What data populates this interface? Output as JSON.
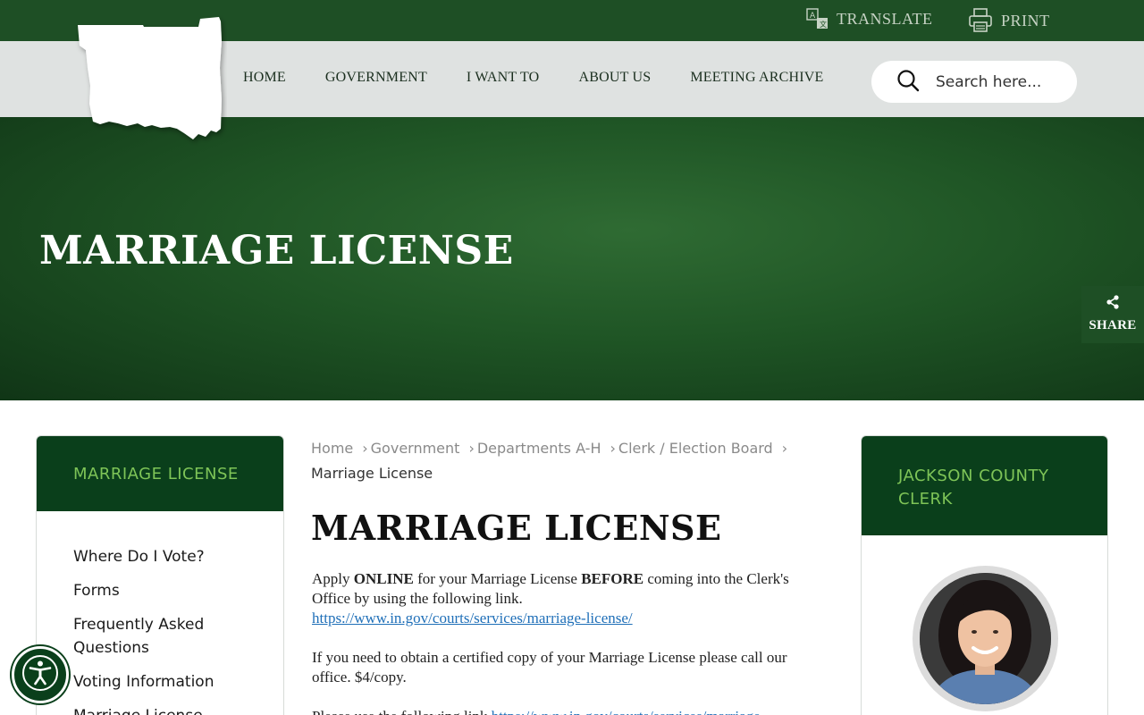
{
  "utility": {
    "translate_label": "TRANSLATE",
    "print_label": "PRINT"
  },
  "nav": {
    "items": [
      {
        "label": "HOME"
      },
      {
        "label": "GOVERNMENT"
      },
      {
        "label": "I WANT TO"
      },
      {
        "label": "ABOUT US"
      },
      {
        "label": "MEETING ARCHIVE"
      }
    ]
  },
  "search": {
    "placeholder": "Search here..."
  },
  "hero": {
    "title": "MARRIAGE LICENSE",
    "share_label": "SHARE"
  },
  "sidebar": {
    "title": "MARRIAGE LICENSE",
    "items": [
      {
        "label": "Where Do I Vote?"
      },
      {
        "label": "Forms"
      },
      {
        "label": "Frequently Asked Questions"
      },
      {
        "label": "Voting Information"
      },
      {
        "label": "Marriage License"
      }
    ]
  },
  "breadcrumb": {
    "items": [
      {
        "label": "Home"
      },
      {
        "label": "Government"
      },
      {
        "label": "Departments A-H"
      },
      {
        "label": "Clerk / Election Board"
      }
    ],
    "current": "Marriage License"
  },
  "main": {
    "title": "MARRIAGE LICENSE",
    "p1_pre": "Apply ",
    "p1_bold1": "ONLINE",
    "p1_mid": " for your Marriage License ",
    "p1_bold2": "BEFORE",
    "p1_post": " coming into the Clerk's Office by using the following link.",
    "p1_link": "https://www.in.gov/courts/services/marriage-license/",
    "p2": "If you need to obtain a certified copy of your Marriage License please call our office. $4/copy.",
    "p3_pre": "Please use the following link ",
    "p3_link": "https://www.in.gov/courts/services/marriage"
  },
  "right_card": {
    "title": "JACKSON COUNTY CLERK"
  },
  "colors": {
    "topbar": "#1e4f25",
    "navbar": "#dfe2e1",
    "card_header": "#0a3f1b",
    "card_title": "#7ec457",
    "link": "#1f6fb8"
  }
}
